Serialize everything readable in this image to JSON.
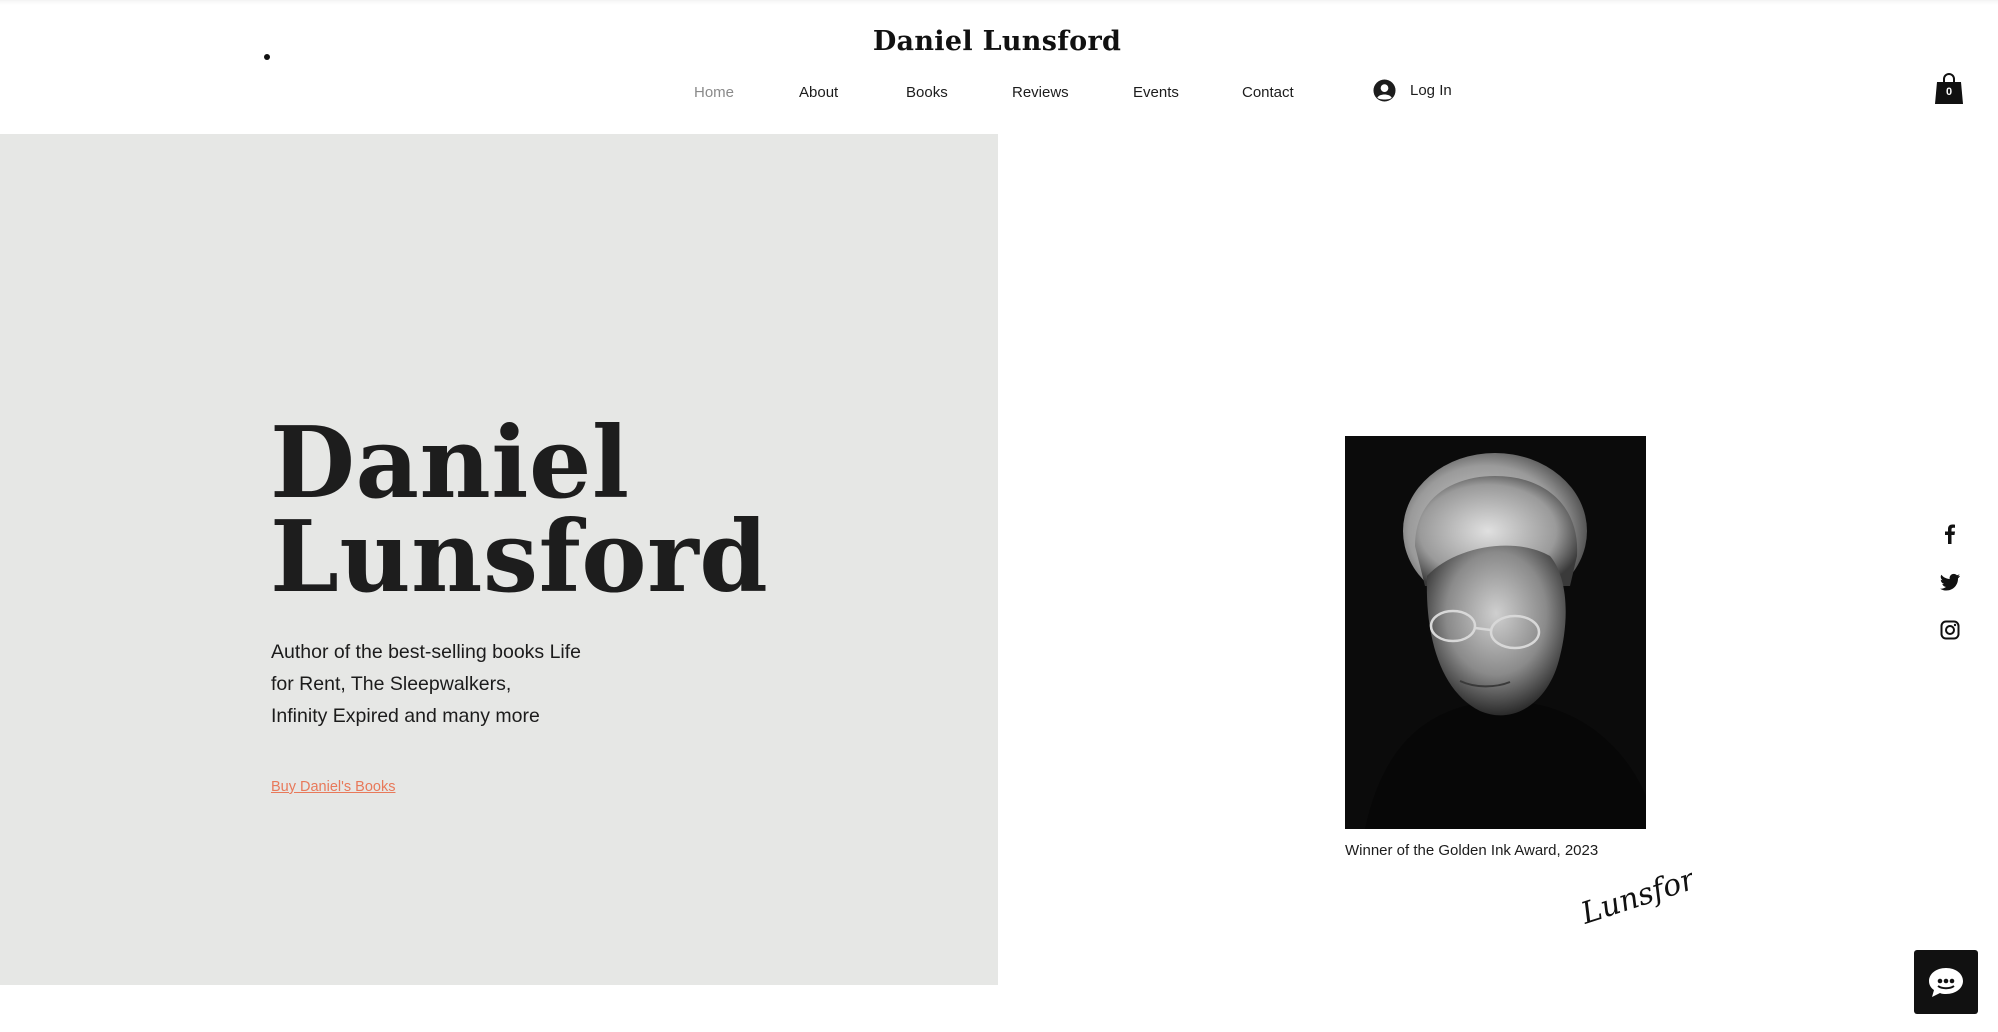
{
  "header": {
    "site_title": "Daniel Lunsford",
    "nav": [
      {
        "label": "Home",
        "active": true
      },
      {
        "label": "About",
        "active": false
      },
      {
        "label": "Books",
        "active": false
      },
      {
        "label": "Reviews",
        "active": false
      },
      {
        "label": "Events",
        "active": false
      },
      {
        "label": "Contact",
        "active": false
      }
    ],
    "login_label": "Log In",
    "login_icon": "user-avatar-icon",
    "cart_icon": "shopping-bag-icon",
    "cart_count": "0"
  },
  "hero": {
    "name_line1": "Daniel",
    "name_line2": "Lunsford",
    "subtitle_lines": [
      "Author of the best-selling books Life",
      "for Rent, The Sleepwalkers,",
      "Infinity Expired and many more"
    ],
    "cta_label": "Buy Daniel's Books",
    "background_color": "#e6e7e5",
    "link_color": "#e8795a"
  },
  "portrait": {
    "caption": "Winner of the Golden Ink Award, 2023",
    "signature_text": "Lunsford"
  },
  "social": [
    {
      "icon": "facebook-icon"
    },
    {
      "icon": "twitter-icon"
    },
    {
      "icon": "instagram-icon"
    }
  ],
  "chat": {
    "icon": "chat-icon"
  }
}
